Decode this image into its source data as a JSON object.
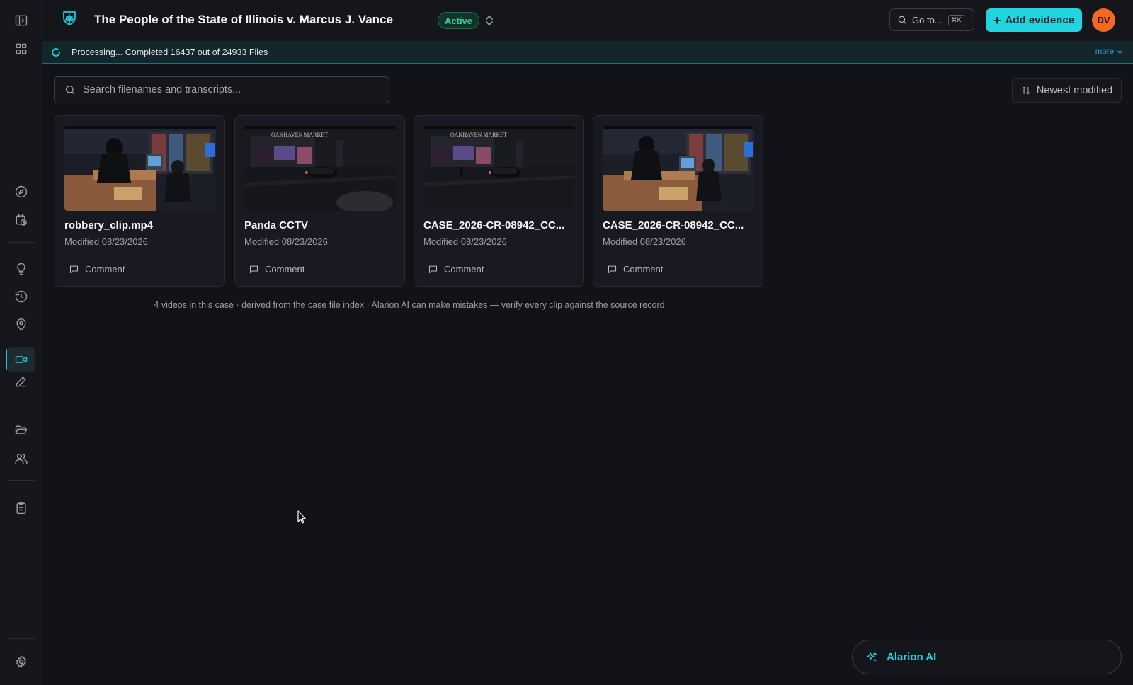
{
  "header": {
    "case_title": "The People of the State of Illinois v. Marcus J. Vance",
    "status": "Active",
    "goto_label": "Go to...",
    "goto_shortcut": "⌘K",
    "add_evidence_label": "Add evidence",
    "avatar_initials": "DV"
  },
  "processing": {
    "text": "Processing... Completed 16437 out of 24933 Files",
    "more_label": "more"
  },
  "search": {
    "placeholder": "Search filenames and transcripts..."
  },
  "sort": {
    "label": "Newest modified"
  },
  "cards": [
    {
      "title": "robbery_clip.mp4",
      "modified": "Modified 08/23/2026",
      "comment_label": "Comment",
      "thumbnail": "interior-store-robbery"
    },
    {
      "title": "Panda CCTV",
      "modified": "Modified 08/23/2026",
      "comment_label": "Comment",
      "thumbnail": "exterior-oakhaven-market"
    },
    {
      "title": "CASE_2026-CR-08942_CC...",
      "modified": "Modified 08/23/2026",
      "comment_label": "Comment",
      "thumbnail": "exterior-oakhaven-market"
    },
    {
      "title": "CASE_2026-CR-08942_CC...",
      "modified": "Modified 08/23/2026",
      "comment_label": "Comment",
      "thumbnail": "interior-store-robbery"
    }
  ],
  "thumb_text": {
    "market_sign": "OAKHAVEN MARKET"
  },
  "footnote": "4 videos in this case · derived from the case file index · Alarion AI can make mistakes — verify every clip against the source record",
  "ai_assistant": {
    "label": "Alarion AI"
  },
  "colors": {
    "accent": "#22d3e0",
    "status_green": "#36d399",
    "avatar": "#f26a21",
    "background": "#121318"
  }
}
